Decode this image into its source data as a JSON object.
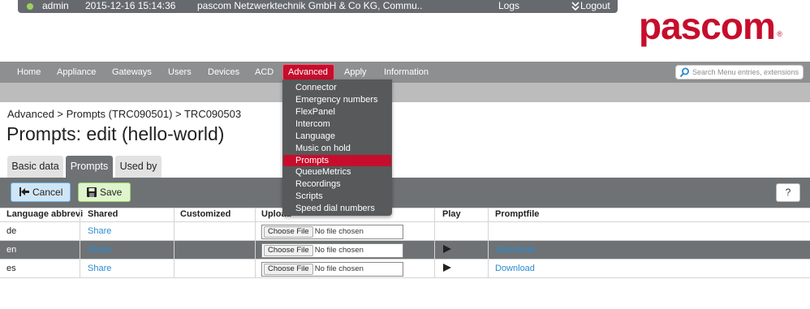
{
  "topbar": {
    "user": "admin",
    "datetime": "2015-12-16 15:14:36",
    "company": "pascom Netzwerktechnik GmbH & Co KG, Commu..",
    "logs": "Logs",
    "logout": "Logout"
  },
  "logo": {
    "text": "pascom",
    "mark": "®"
  },
  "nav": {
    "items": [
      "Home",
      "Appliance",
      "Gateways",
      "Users",
      "Devices",
      "ACD",
      "Advanced",
      "Apply",
      "Information"
    ],
    "active": "Advanced",
    "search_placeholder": "Search Menu entries, extensions"
  },
  "dropdown": {
    "items": [
      "Connector",
      "Emergency numbers",
      "FlexPanel",
      "Intercom",
      "Language",
      "Music on hold",
      "Prompts",
      "QueueMetrics",
      "Recordings",
      "Scripts",
      "Speed dial numbers"
    ],
    "selected": "Prompts"
  },
  "breadcrumb": "Advanced > Prompts (TRC090501) > TRC090503",
  "page_title": "Prompts: edit (hello-world)",
  "tabs": [
    "Basic data",
    "Prompts",
    "Used by"
  ],
  "active_tab": "Prompts",
  "buttons": {
    "cancel": "Cancel",
    "save": "Save",
    "help": "?"
  },
  "table": {
    "headers": [
      "Language abbrevi",
      "Shared",
      "Customized",
      "Upload",
      "Play",
      "Promptfile"
    ],
    "file_button": "Choose File",
    "file_text": "No file chosen",
    "rows": [
      {
        "language": "de",
        "shared": "Share",
        "customized": "",
        "play": false,
        "promptfile": ""
      },
      {
        "language": "en",
        "shared": "Share",
        "customized": "",
        "play": true,
        "promptfile": "Download"
      },
      {
        "language": "es",
        "shared": "Share",
        "customized": "",
        "play": true,
        "promptfile": "Download"
      }
    ]
  },
  "colors": {
    "brand": "#c70d2c",
    "nav": "#8d8f91",
    "bar": "#6e7275",
    "link": "#2a8bd0"
  }
}
